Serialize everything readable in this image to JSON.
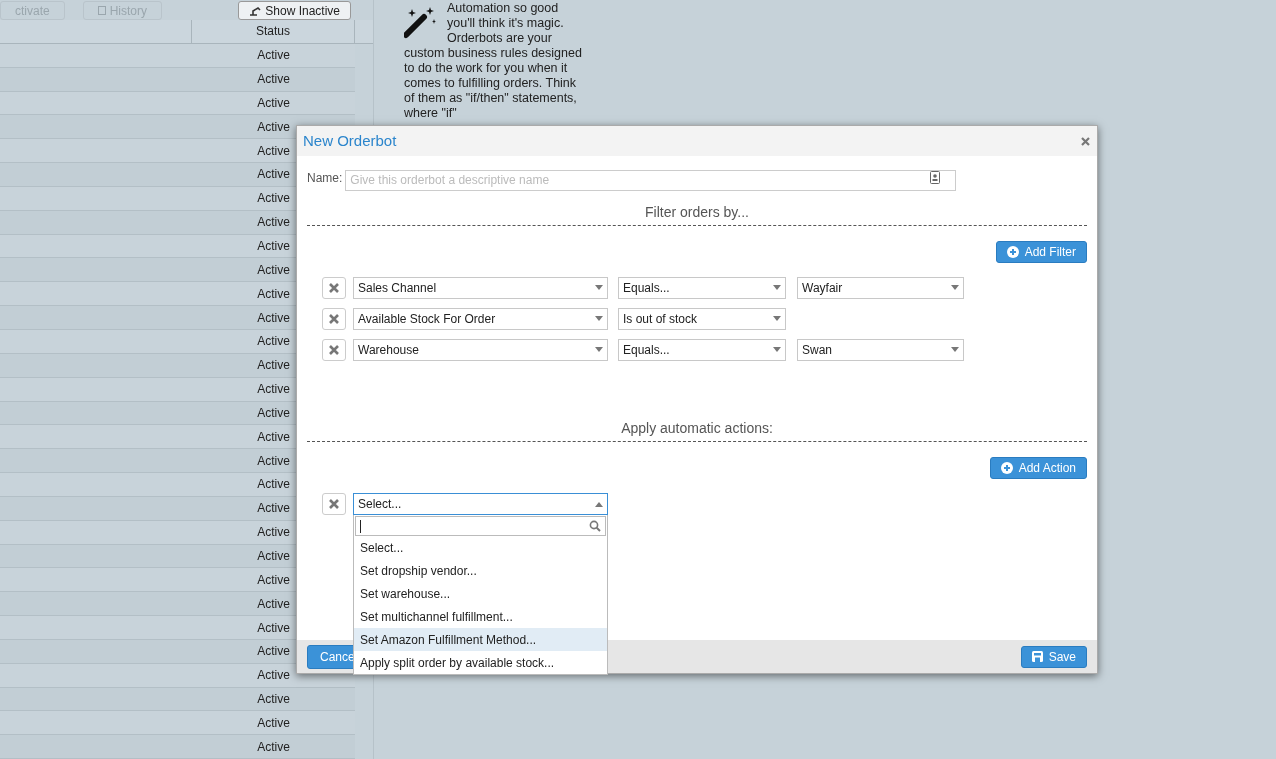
{
  "toolbar": {
    "buttons": [
      {
        "label": "ctivate",
        "disabled": true
      },
      {
        "label": "History",
        "disabled": true
      },
      {
        "label": "Show Inactive",
        "disabled": false
      }
    ]
  },
  "table": {
    "columns": [
      "Status"
    ],
    "rows": [
      {
        "status": "Active"
      },
      {
        "status": "Active"
      },
      {
        "status": "Active"
      },
      {
        "status": "Active"
      },
      {
        "status": "Active"
      },
      {
        "status": "Active"
      },
      {
        "status": "Active"
      },
      {
        "status": "Active"
      },
      {
        "status": "Active"
      },
      {
        "status": "Active"
      },
      {
        "status": "Active"
      },
      {
        "status": "Active"
      },
      {
        "status": "Active"
      },
      {
        "status": "Active"
      },
      {
        "status": "Active"
      },
      {
        "status": "Active"
      },
      {
        "status": "Active"
      },
      {
        "status": "Active"
      },
      {
        "status": "Active"
      },
      {
        "status": "Active"
      },
      {
        "status": "Active"
      },
      {
        "status": "Active"
      },
      {
        "status": "Active"
      },
      {
        "status": "Active"
      },
      {
        "status": "Active"
      },
      {
        "status": "Active"
      },
      {
        "status": "Active"
      },
      {
        "status": "Active"
      },
      {
        "status": "Active"
      },
      {
        "status": "Active"
      }
    ]
  },
  "info": {
    "lead": "Automation so good you'll think it's magic. Orderbots are your",
    "text": "custom business rules designed to do the work for you when it comes to fulfilling orders. Think of them as \"if/then\" statements, where \"if\""
  },
  "dialog": {
    "title": "New Orderbot",
    "name_field": {
      "label": "Name:",
      "placeholder": "Give this orderbot a descriptive name"
    },
    "filters": {
      "heading": "Filter orders by...",
      "add_button": "Add Filter",
      "rows": [
        {
          "field": "Sales Channel",
          "operator": "Equals...",
          "value": "Wayfair"
        },
        {
          "field": "Available Stock For Order",
          "operator": "Is out of stock"
        },
        {
          "field": "Warehouse",
          "operator": "Equals...",
          "value": "Swan"
        }
      ]
    },
    "actions": {
      "heading": "Apply automatic actions:",
      "add_button": "Add Action",
      "rows": [
        {
          "value": "Select...",
          "expanded": true,
          "options": [
            {
              "label": "Select...",
              "highlighted": false
            },
            {
              "label": "Set dropship vendor...",
              "highlighted": false
            },
            {
              "label": "Set warehouse...",
              "highlighted": false
            },
            {
              "label": "Set multichannel fulfillment...",
              "highlighted": false
            },
            {
              "label": "Set Amazon Fulfillment Method...",
              "highlighted": true
            },
            {
              "label": "Apply split order by available stock...",
              "highlighted": false
            }
          ]
        }
      ]
    },
    "footer": {
      "cancel": "Cance",
      "save": "Save"
    }
  }
}
